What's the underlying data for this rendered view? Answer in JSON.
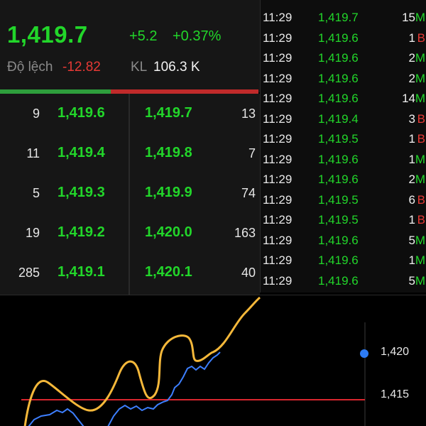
{
  "quote": {
    "price": "1,419.7",
    "change": "+5.2",
    "change_pct": "+0.37%",
    "basis_label": "Độ lệch",
    "basis_value": "-12.82",
    "volume_label": "KL",
    "volume_value": "106.3 K"
  },
  "depth": {
    "bids": [
      {
        "qty": "9",
        "price": "1,419.6"
      },
      {
        "qty": "11",
        "price": "1,419.4"
      },
      {
        "qty": "5",
        "price": "1,419.3"
      },
      {
        "qty": "19",
        "price": "1,419.2"
      },
      {
        "qty": "285",
        "price": "1,419.1"
      }
    ],
    "asks": [
      {
        "price": "1,419.7",
        "qty": "13"
      },
      {
        "price": "1,419.8",
        "qty": "7"
      },
      {
        "price": "1,419.9",
        "qty": "74"
      },
      {
        "price": "1,420.0",
        "qty": "163"
      },
      {
        "price": "1,420.1",
        "qty": "40"
      }
    ]
  },
  "trades": [
    {
      "time": "11:29",
      "price": "1,419.7",
      "vol": "15",
      "side": "M"
    },
    {
      "time": "11:29",
      "price": "1,419.6",
      "vol": "1",
      "side": "B"
    },
    {
      "time": "11:29",
      "price": "1,419.6",
      "vol": "2",
      "side": "M"
    },
    {
      "time": "11:29",
      "price": "1,419.6",
      "vol": "2",
      "side": "M"
    },
    {
      "time": "11:29",
      "price": "1,419.6",
      "vol": "14",
      "side": "M"
    },
    {
      "time": "11:29",
      "price": "1,419.4",
      "vol": "3",
      "side": "B"
    },
    {
      "time": "11:29",
      "price": "1,419.5",
      "vol": "1",
      "side": "B"
    },
    {
      "time": "11:29",
      "price": "1,419.6",
      "vol": "1",
      "side": "M"
    },
    {
      "time": "11:29",
      "price": "1,419.6",
      "vol": "2",
      "side": "M"
    },
    {
      "time": "11:29",
      "price": "1,419.5",
      "vol": "6",
      "side": "B"
    },
    {
      "time": "11:29",
      "price": "1,419.5",
      "vol": "1",
      "side": "B"
    },
    {
      "time": "11:29",
      "price": "1,419.6",
      "vol": "5",
      "side": "M"
    },
    {
      "time": "11:29",
      "price": "1,419.6",
      "vol": "1",
      "side": "M"
    },
    {
      "time": "11:29",
      "price": "1,419.6",
      "vol": "5",
      "side": "M"
    }
  ],
  "chart": {
    "axis_labels": [
      "1,420",
      "1,415"
    ],
    "colors": {
      "price_line": "#3d7fff",
      "overlay_line": "#f5b83a",
      "reference_line": "#d8262e",
      "marker": "#2d7cf6"
    }
  }
}
